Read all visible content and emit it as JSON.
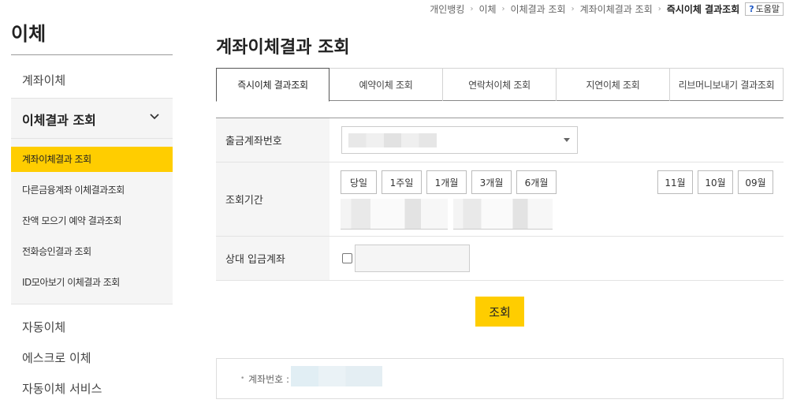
{
  "breadcrumb": {
    "items": [
      "개인뱅킹",
      "이체",
      "이체결과 조회",
      "계좌이체결과 조회"
    ],
    "current": "즉시이체 결과조회",
    "help_icon": "?",
    "help_label": "도움말"
  },
  "sidebar": {
    "title": "이체",
    "top_item": "계좌이체",
    "group": {
      "label": "이체결과 조회",
      "expanded": true,
      "items": [
        {
          "label": "계좌이체결과 조회",
          "active": true
        },
        {
          "label": "다른금융계좌 이체결과조회",
          "active": false
        },
        {
          "label": "잔액 모으기 예약 결과조회",
          "active": false
        },
        {
          "label": "전화승인결과 조회",
          "active": false
        },
        {
          "label": "ID모아보기 이체결과 조회",
          "active": false
        }
      ]
    },
    "bottom_items": [
      "자동이체",
      "에스크로 이체",
      "자동이체 서비스"
    ]
  },
  "main": {
    "title": "계좌이체결과 조회",
    "tabs": [
      {
        "label": "즉시이체 결과조회",
        "active": true
      },
      {
        "label": "예약이체 조회",
        "active": false
      },
      {
        "label": "연락처이체 조회",
        "active": false
      },
      {
        "label": "지연이체 조회",
        "active": false
      },
      {
        "label": "리브머니보내기 결과조회",
        "active": false
      }
    ],
    "form": {
      "account_label": "출금계좌번호",
      "period_label": "조회기간",
      "period_buttons": [
        "당일",
        "1주일",
        "1개월",
        "3개월",
        "6개월"
      ],
      "month_buttons": [
        "11월",
        "10월",
        "09월"
      ],
      "counterparty_label": "상대 입금계좌"
    },
    "search_label": "조회",
    "info": {
      "bullet": "•",
      "account_label": "계좌번호 :"
    }
  },
  "colors": {
    "accent": "#ffcd00",
    "label_bg": "#f5f5f5"
  }
}
